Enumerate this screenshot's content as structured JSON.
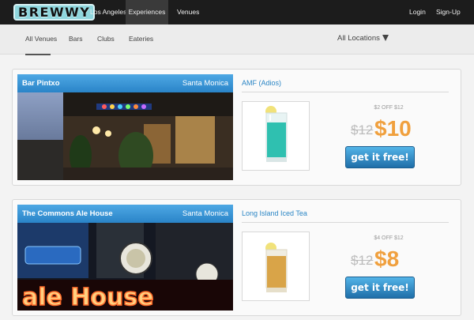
{
  "brand": {
    "logo_text": "BREWWY"
  },
  "topnav": {
    "location": "Los Angeles»",
    "experiences": "Experiences",
    "venues": "Venues",
    "login": "Login",
    "signup": "Sign-Up"
  },
  "subnav": {
    "tabs": [
      "All Venues",
      "Bars",
      "Clubs",
      "Eateries"
    ],
    "location_filter": "All Locations"
  },
  "deals": [
    {
      "venue": "Bar Pintxo",
      "city": "Santa Monica",
      "drink": "AMF (Adios)",
      "caption": "$2 OFF $12",
      "old_price": "$12",
      "new_price": "$10",
      "cta": "get it free!"
    },
    {
      "venue": "The Commons Ale House",
      "city": "Santa Monica",
      "drink": "Long Island Iced Tea",
      "caption": "$4 OFF $12",
      "old_price": "$12",
      "new_price": "$8",
      "cta": "get it free!"
    }
  ],
  "colors": {
    "accent_blue": "#2b86c5",
    "price_orange": "#f0a03e",
    "nav_dark": "#1c1c1c",
    "logo_teal": "#8fd6dd"
  }
}
